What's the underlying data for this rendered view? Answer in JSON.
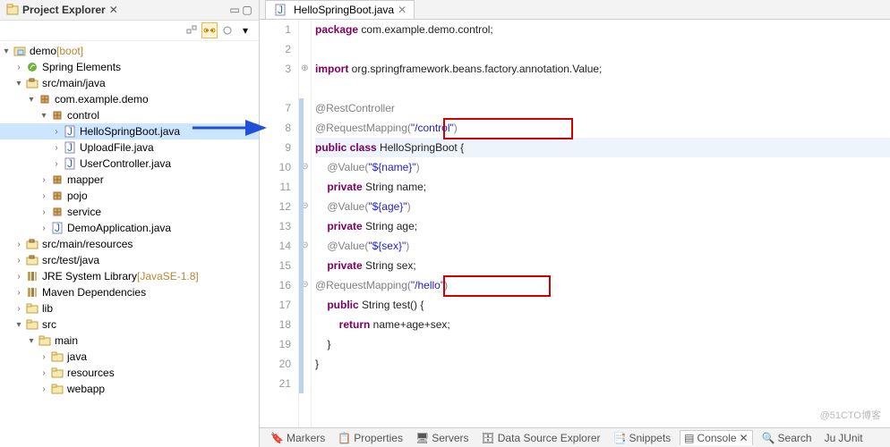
{
  "sidebar": {
    "title": "Project Explorer",
    "tree": [
      {
        "depth": 0,
        "exp": "▾",
        "icon": "project",
        "label": "demo",
        "suffix": " [boot]",
        "suffixColor": "#b9872e"
      },
      {
        "depth": 1,
        "exp": "›",
        "icon": "spring",
        "label": "Spring Elements"
      },
      {
        "depth": 1,
        "exp": "▾",
        "icon": "srcfolder",
        "label": "src/main/java"
      },
      {
        "depth": 2,
        "exp": "▾",
        "icon": "package",
        "label": "com.example.demo"
      },
      {
        "depth": 3,
        "exp": "▾",
        "icon": "package",
        "label": "control"
      },
      {
        "depth": 4,
        "exp": "›",
        "icon": "javafile",
        "label": "HelloSpringBoot.java",
        "selected": true
      },
      {
        "depth": 4,
        "exp": "›",
        "icon": "javafile",
        "label": "UploadFile.java"
      },
      {
        "depth": 4,
        "exp": "›",
        "icon": "javafile",
        "label": "UserController.java"
      },
      {
        "depth": 3,
        "exp": "›",
        "icon": "package",
        "label": "mapper"
      },
      {
        "depth": 3,
        "exp": "›",
        "icon": "package",
        "label": "pojo"
      },
      {
        "depth": 3,
        "exp": "›",
        "icon": "package",
        "label": "service"
      },
      {
        "depth": 3,
        "exp": "›",
        "icon": "javafile",
        "label": "DemoApplication.java"
      },
      {
        "depth": 1,
        "exp": "›",
        "icon": "srcfolder",
        "label": "src/main/resources"
      },
      {
        "depth": 1,
        "exp": "›",
        "icon": "srcfolder",
        "label": "src/test/java"
      },
      {
        "depth": 1,
        "exp": "›",
        "icon": "library",
        "label": "JRE System Library",
        "suffix": " [JavaSE-1.8]",
        "suffixColor": "#b9872e"
      },
      {
        "depth": 1,
        "exp": "›",
        "icon": "library",
        "label": "Maven Dependencies"
      },
      {
        "depth": 1,
        "exp": "›",
        "icon": "folder",
        "label": "lib"
      },
      {
        "depth": 1,
        "exp": "▾",
        "icon": "folder",
        "label": "src"
      },
      {
        "depth": 2,
        "exp": "▾",
        "icon": "folder",
        "label": "main"
      },
      {
        "depth": 3,
        "exp": "›",
        "icon": "folder",
        "label": "java"
      },
      {
        "depth": 3,
        "exp": "›",
        "icon": "folder",
        "label": "resources"
      },
      {
        "depth": 3,
        "exp": "›",
        "icon": "folder",
        "label": "webapp"
      }
    ]
  },
  "editor": {
    "tab": "HelloSpringBoot.java",
    "lines": [
      {
        "n": "1",
        "seg": [
          {
            "c": "kw",
            "t": "package"
          },
          {
            "c": "plain",
            "t": " com.example.demo.control;"
          }
        ]
      },
      {
        "n": "2",
        "seg": [
          {
            "c": "plain",
            "t": ""
          }
        ]
      },
      {
        "n": "3",
        "fold": "+",
        "seg": [
          {
            "c": "kw",
            "t": "import"
          },
          {
            "c": "plain",
            "t": " org.springframework.beans.factory.annotation.Value;"
          }
        ]
      },
      {
        "n": "",
        "seg": [
          {
            "c": "plain",
            "t": ""
          }
        ]
      },
      {
        "n": "7",
        "seg": [
          {
            "c": "anno",
            "t": "@RestController"
          }
        ]
      },
      {
        "n": "8",
        "seg": [
          {
            "c": "anno",
            "t": "@RequestMapping("
          },
          {
            "c": "str",
            "t": "\"/control\""
          },
          {
            "c": "anno",
            "t": ")"
          }
        ]
      },
      {
        "n": "9",
        "hl": true,
        "seg": [
          {
            "c": "kw",
            "t": "public class"
          },
          {
            "c": "plain",
            "t": " HelloSpringBoot {"
          }
        ]
      },
      {
        "n": "10",
        "fold": "-",
        "seg": [
          {
            "c": "plain",
            "t": "    "
          },
          {
            "c": "anno",
            "t": "@Value("
          },
          {
            "c": "str",
            "t": "\"${name}\""
          },
          {
            "c": "anno",
            "t": ")"
          }
        ]
      },
      {
        "n": "11",
        "seg": [
          {
            "c": "plain",
            "t": "    "
          },
          {
            "c": "kw",
            "t": "private"
          },
          {
            "c": "plain",
            "t": " String name;"
          }
        ]
      },
      {
        "n": "12",
        "fold": "-",
        "seg": [
          {
            "c": "plain",
            "t": "    "
          },
          {
            "c": "anno",
            "t": "@Value("
          },
          {
            "c": "str",
            "t": "\"${age}\""
          },
          {
            "c": "anno",
            "t": ")"
          }
        ]
      },
      {
        "n": "13",
        "seg": [
          {
            "c": "plain",
            "t": "    "
          },
          {
            "c": "kw",
            "t": "private"
          },
          {
            "c": "plain",
            "t": " String age;"
          }
        ]
      },
      {
        "n": "14",
        "fold": "-",
        "seg": [
          {
            "c": "plain",
            "t": "    "
          },
          {
            "c": "anno",
            "t": "@Value("
          },
          {
            "c": "str",
            "t": "\"${sex}\""
          },
          {
            "c": "anno",
            "t": ")"
          }
        ]
      },
      {
        "n": "15",
        "seg": [
          {
            "c": "plain",
            "t": "    "
          },
          {
            "c": "kw",
            "t": "private"
          },
          {
            "c": "plain",
            "t": " String sex;"
          }
        ]
      },
      {
        "n": "16",
        "fold": "-",
        "seg": [
          {
            "c": "anno",
            "t": "@RequestMapping("
          },
          {
            "c": "str",
            "t": "\"/hello\""
          },
          {
            "c": "anno",
            "t": ")"
          }
        ]
      },
      {
        "n": "17",
        "seg": [
          {
            "c": "plain",
            "t": "    "
          },
          {
            "c": "kw",
            "t": "public"
          },
          {
            "c": "plain",
            "t": " String test() {"
          }
        ]
      },
      {
        "n": "18",
        "seg": [
          {
            "c": "plain",
            "t": "        "
          },
          {
            "c": "kw",
            "t": "return"
          },
          {
            "c": "plain",
            "t": " name+age+sex;"
          }
        ]
      },
      {
        "n": "19",
        "seg": [
          {
            "c": "plain",
            "t": "    }"
          }
        ]
      },
      {
        "n": "20",
        "seg": [
          {
            "c": "plain",
            "t": "}"
          }
        ]
      },
      {
        "n": "21",
        "seg": [
          {
            "c": "plain",
            "t": ""
          }
        ]
      }
    ]
  },
  "bottomTabs": [
    {
      "label": "Markers",
      "icon": "🔖"
    },
    {
      "label": "Properties",
      "icon": "📋"
    },
    {
      "label": "Servers",
      "icon": "🖥"
    },
    {
      "label": "Data Source Explorer",
      "icon": "🗄"
    },
    {
      "label": "Snippets",
      "icon": "📑"
    },
    {
      "label": "Console",
      "icon": "▤",
      "active": true
    },
    {
      "label": "Search",
      "icon": "🔍"
    },
    {
      "label": "JUnit",
      "icon": "Ju"
    }
  ],
  "watermark": "@51CTO博客"
}
